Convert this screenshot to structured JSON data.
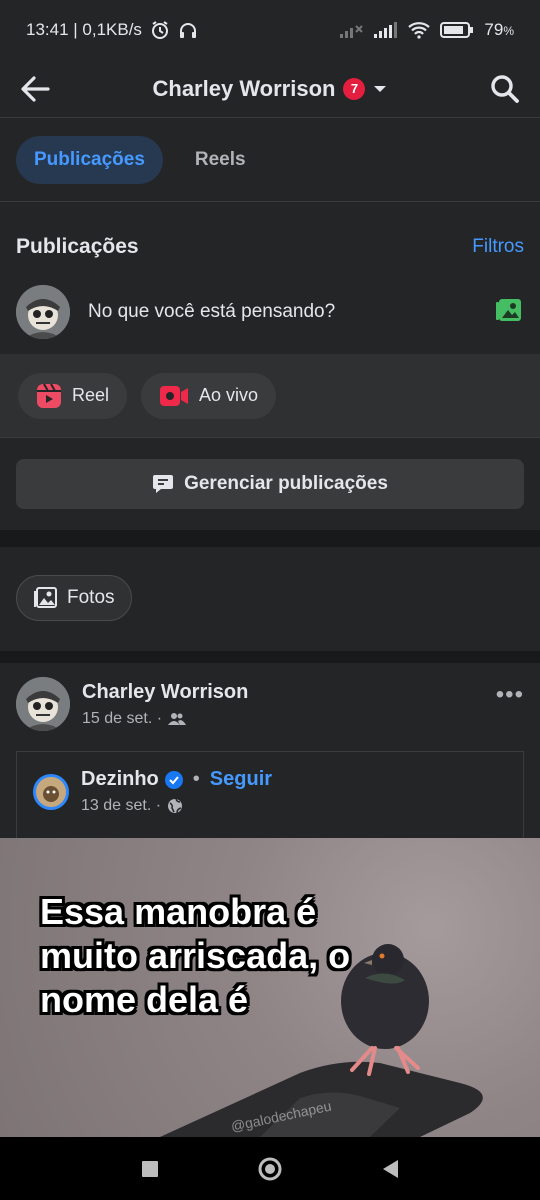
{
  "status": {
    "time": "13:41 | 0,1KB/s",
    "battery": "79",
    "battery_unit": "%"
  },
  "appbar": {
    "title": "Charley Worrison",
    "badge": "7"
  },
  "tabs": [
    {
      "label": "Publicações",
      "active": true
    },
    {
      "label": "Reels",
      "active": false
    }
  ],
  "posts_section": {
    "title": "Publicações",
    "filter_label": "Filtros",
    "composer_placeholder": "No que você está pensando?"
  },
  "actions": {
    "reel_label": "Reel",
    "live_label": "Ao vivo"
  },
  "manage": {
    "label": "Gerenciar publicações"
  },
  "photos": {
    "label": "Fotos"
  },
  "post": {
    "author": "Charley Worrison",
    "date": "15 de set. ·",
    "more": "•••",
    "shared": {
      "author": "Dezinho",
      "separator": "•",
      "follow_label": "Seguir",
      "date": "13 de set. ·"
    },
    "meme_lines": [
      "Essa manobra é",
      "muito arriscada, o",
      "nome dela é"
    ],
    "watermark": "@galodechapeu"
  },
  "colors": {
    "accent": "#4599ff",
    "badge": "#e41e3f",
    "background": "#242526"
  },
  "icons": {
    "back": "arrow-left-icon",
    "search": "search-icon",
    "photo": "photo-icon",
    "reel": "reel-icon",
    "live": "live-video-icon",
    "manage": "chat-bubble-icon",
    "friends": "friends-icon",
    "globe": "globe-icon"
  }
}
